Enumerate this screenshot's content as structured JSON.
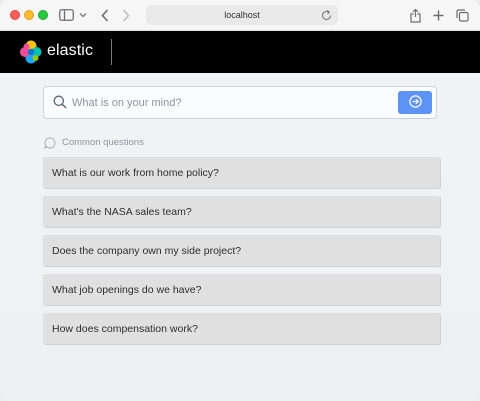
{
  "browser": {
    "address": "localhost"
  },
  "header": {
    "brand": "elastic"
  },
  "search": {
    "placeholder": "What is on your mind?",
    "value": ""
  },
  "common_questions": {
    "label": "Common questions",
    "items": [
      "What is our work from home policy?",
      "What's the NASA sales team?",
      "Does the company own my side project?",
      "What job openings do we have?",
      "How does compensation work?"
    ]
  },
  "colors": {
    "accent": "#5c93f5",
    "header": "#000000",
    "question_bg": "#e0e0e0"
  }
}
